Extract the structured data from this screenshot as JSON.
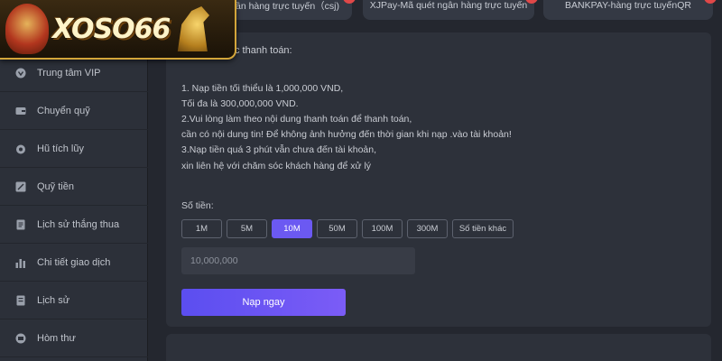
{
  "brand": {
    "logo_text": "XOSO66"
  },
  "sidebar": {
    "items": [
      {
        "label": "Trung tâm VIP",
        "icon": "vip-icon"
      },
      {
        "label": "Chuyển quỹ",
        "icon": "wallet-icon"
      },
      {
        "label": "Hũ tích lũy",
        "icon": "jar-icon"
      },
      {
        "label": "Quỹ tiền",
        "icon": "fund-icon"
      },
      {
        "label": "Lịch sử thắng thua",
        "icon": "history-doc-icon"
      },
      {
        "label": "Chi tiết giao dịch",
        "icon": "chart-bars-icon"
      },
      {
        "label": "Lịch sử",
        "icon": "history-icon"
      },
      {
        "label": "Hòm thư",
        "icon": "mailbox-icon"
      }
    ]
  },
  "payment_tabs": [
    {
      "label": "ần hàng trực tuyến（csj)"
    },
    {
      "label": "XJPay-Mã quét ngân hàng trực tuyến"
    },
    {
      "label": "BANKPAY-hàng trực tuyếnQR"
    }
  ],
  "main": {
    "heading": "c thanh toán:",
    "instructions": [
      "1. Nạp tiền tối thiểu là 1,000,000 VND,",
      "Tối đa là 300,000,000 VND.",
      "2.Vui lòng làm theo nội dung thanh toán để thanh toán,",
      "cần có nội dung tin! Để không ảnh hưởng đến thời gian khi nạp .vào tài khoản!",
      "3.Nạp tiền quá 3 phút vẫn chưa đến tài khoản,",
      "xin liên hệ với chăm sóc khách hàng để xử lý"
    ],
    "amount_label": "Số tiền:",
    "amount_options": [
      "1M",
      "5M",
      "10M",
      "50M",
      "100M",
      "300M",
      "Số tiền khác"
    ],
    "selected_amount": "10M",
    "amount_value": "10,000,000",
    "submit_label": "Nạp ngay"
  },
  "colors": {
    "accent": "#6b59f2",
    "badge": "#e04848",
    "background": "#24272f",
    "panel": "#2d313a",
    "logo_border": "#d3a53a"
  }
}
